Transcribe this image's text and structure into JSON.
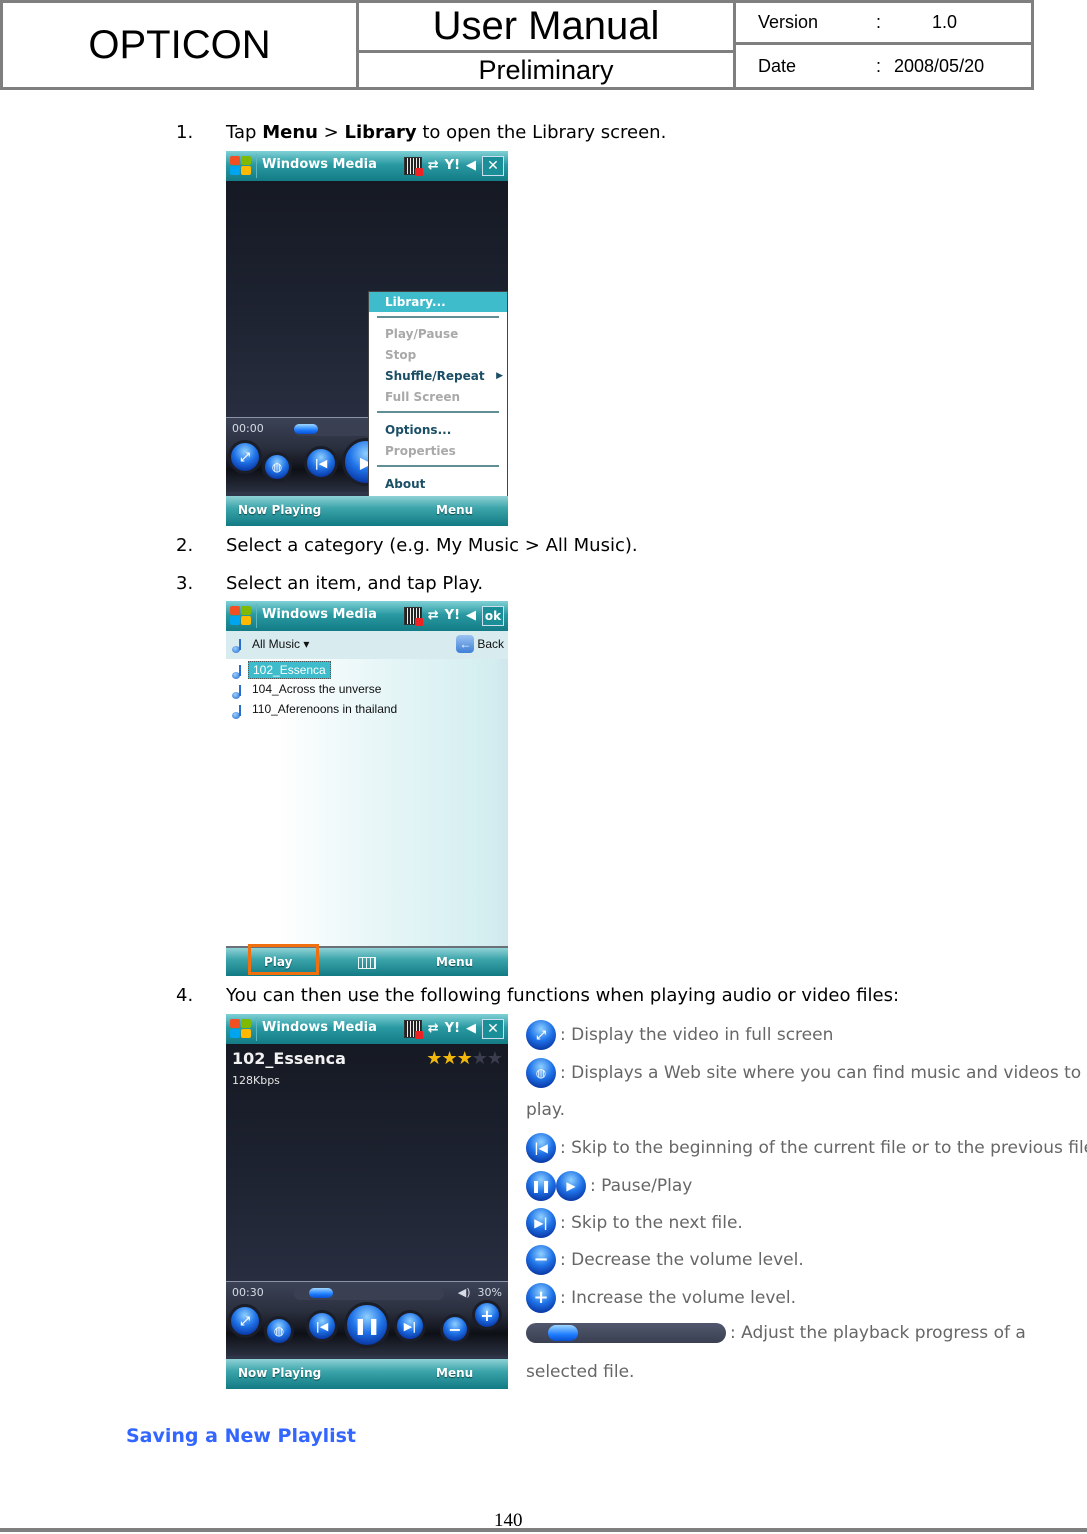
{
  "header": {
    "brand": "OPTICON",
    "title": "User Manual",
    "subtitle": "Preliminary",
    "version_label": "Version",
    "version_sep": ":",
    "version_value": "1.0",
    "date_label": "Date",
    "date_sep": ":",
    "date_value": "2008/05/20"
  },
  "steps": [
    {
      "num": "1.",
      "pre": "Tap ",
      "b1": "Menu",
      "mid": " > ",
      "b2": "Library",
      "post": " to open the Library screen."
    },
    {
      "num": "2.",
      "text": "Select a category (e.g. My Music > All Music)."
    },
    {
      "num": "3.",
      "text": "Select an item, and tap Play."
    },
    {
      "num": "4.",
      "text": "You can then use the following functions when playing audio or video files:"
    }
  ],
  "screen1": {
    "title": "Windows Media",
    "close_label": "✕",
    "time": "00:00",
    "progress_fraction": 0.0,
    "menu_items": [
      {
        "label": "Library...",
        "state": "selected"
      },
      {
        "label": "Play/Pause",
        "state": "disabled"
      },
      {
        "label": "Stop",
        "state": "disabled"
      },
      {
        "label": "Shuffle/Repeat",
        "state": "enabled",
        "submenu": true
      },
      {
        "label": "Full Screen",
        "state": "disabled"
      },
      {
        "label": "Options...",
        "state": "enabled"
      },
      {
        "label": "Properties",
        "state": "disabled"
      },
      {
        "label": "About",
        "state": "enabled"
      }
    ],
    "soft_left": "Now Playing",
    "soft_right": "Menu"
  },
  "screen2": {
    "title": "Windows Media",
    "ok_label": "ok",
    "category": "All Music ▾",
    "back_label": "Back",
    "items": [
      "102_Essenca",
      "104_Across the unverse",
      "110_Aferenoons in thailand"
    ],
    "selected_index": 0,
    "soft_left": "Play",
    "soft_right": "Menu"
  },
  "screen3": {
    "title": "Windows Media",
    "close_label": "✕",
    "track": "102_Essenca",
    "bitrate": "128Kbps",
    "rating": 3,
    "rating_max": 5,
    "time": "00:30",
    "progress_fraction": 0.12,
    "volume": "30%",
    "soft_left": "Now Playing",
    "soft_right": "Menu"
  },
  "legend": [
    {
      "icon": "fullscreen-icon",
      "glyph": "⤢",
      "text": ": Display the video in full screen"
    },
    {
      "icon": "globe-icon",
      "glyph": "🌐",
      "text": ": Displays a Web site where you can find music and videos to"
    },
    {
      "icon": "",
      "glyph": "",
      "text": "play."
    },
    {
      "icon": "previous-icon",
      "glyph": "|◀",
      "text": ": Skip to the beginning of the current file or to the previous file."
    },
    {
      "icon": "pause-play-icon",
      "glyph": "❚❚",
      "glyph2": "▶",
      "text": ": Pause/Play"
    },
    {
      "icon": "next-icon",
      "glyph": "▶|",
      "text": ": Skip to the next file."
    },
    {
      "icon": "volume-down-icon",
      "glyph": "−",
      "text": ": Decrease the volume level."
    },
    {
      "icon": "volume-up-icon",
      "glyph": "+",
      "text": ": Increase the volume level."
    },
    {
      "icon": "progress-slider",
      "glyph": "",
      "text": ": Adjust the playback progress of a"
    },
    {
      "icon": "",
      "glyph": "",
      "text": "selected file."
    }
  ],
  "section_heading": "Saving a New Playlist",
  "page_number": "140",
  "colors": {
    "heading_blue": "#3366ff",
    "highlight_orange": "#f07010",
    "selection_teal": "#3fbccb"
  }
}
